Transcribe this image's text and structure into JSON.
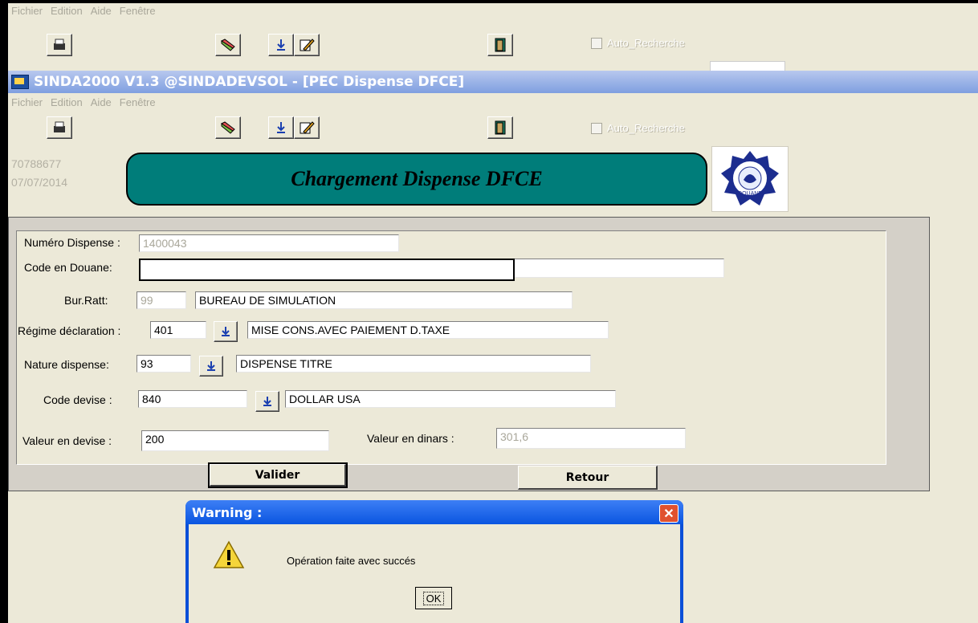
{
  "background_window": {
    "menu": [
      "Fichier",
      "Edition",
      "Aide",
      "Fenêtre"
    ],
    "auto_recherche_label": "Auto_Recherche"
  },
  "window": {
    "title": "SINDA2000 V1.3 @SINDADEVSOL - [PEC Dispense DFCE]",
    "menu": [
      "Fichier",
      "Edition",
      "Aide",
      "Fenêtre"
    ],
    "auto_recherche_label": "Auto_Recherche"
  },
  "header": {
    "user_id": "70788677",
    "date": "07/07/2014",
    "banner_title": "Chargement Dispense DFCE",
    "logo_text": "DOUANE"
  },
  "form": {
    "numero_dispense": {
      "label": "Numéro Dispense :",
      "value": "1400043"
    },
    "code_douane": {
      "label": "Code en Douane:",
      "value": "",
      "extra": ""
    },
    "bur_ratt": {
      "label": "Bur.Ratt:",
      "code": "99",
      "name": "BUREAU DE SIMULATION"
    },
    "regime": {
      "label": "Régime déclaration :",
      "code": "401",
      "name": "MISE CONS.AVEC PAIEMENT D.TAXE"
    },
    "nature": {
      "label": "Nature dispense:",
      "code": "93",
      "name": "DISPENSE TITRE"
    },
    "devise": {
      "label": "Code devise :",
      "code": "840",
      "name": "DOLLAR USA"
    },
    "valeur_devise": {
      "label": "Valeur en  devise :",
      "value": "200"
    },
    "valeur_dinars": {
      "label": "Valeur  en dinars :",
      "value": "301,6"
    },
    "valider_label": "Valider",
    "retour_label": "Retour"
  },
  "dialog": {
    "title": "Warning :",
    "message": "Opération faite avec succés",
    "ok_label": "OK"
  },
  "colors": {
    "banner": "#007d7a",
    "titlebar": "#7f9fe0",
    "dialog": "#0a4fd8"
  }
}
